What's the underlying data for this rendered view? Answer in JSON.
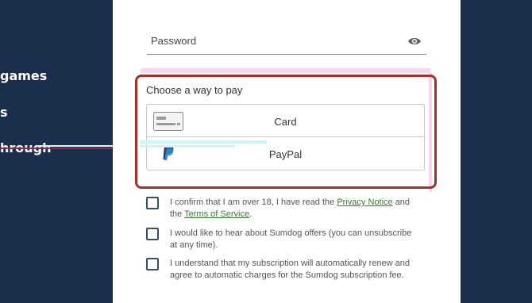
{
  "sidebar": {
    "items": [
      {
        "label": "games"
      },
      {
        "label": "s"
      },
      {
        "label": "hrough"
      }
    ]
  },
  "form": {
    "password_label": "Password",
    "password_toggle_icon": "eye-icon",
    "payment": {
      "title": "Choose a way to pay",
      "options": [
        {
          "label": "Card",
          "icon": "credit-card-icon"
        },
        {
          "label": "PayPal",
          "icon": "paypal-icon"
        }
      ]
    },
    "checkboxes": [
      {
        "text_before": "I confirm that I am over 18, I have read the ",
        "link1": "Privacy Notice",
        "text_mid": " and the ",
        "link2": "Terms of Service",
        "text_after": "."
      },
      {
        "text": "I would like to hear about Sumdog offers (you can unsubscribe at any time)."
      },
      {
        "text": "I understand that my subscription will automatically renew and agree to automatic charges for the Sumdog subscription fee."
      }
    ]
  },
  "colors": {
    "background": "#1b2f4d",
    "highlight_border": "#a7302a",
    "link": "#3c7a35"
  }
}
